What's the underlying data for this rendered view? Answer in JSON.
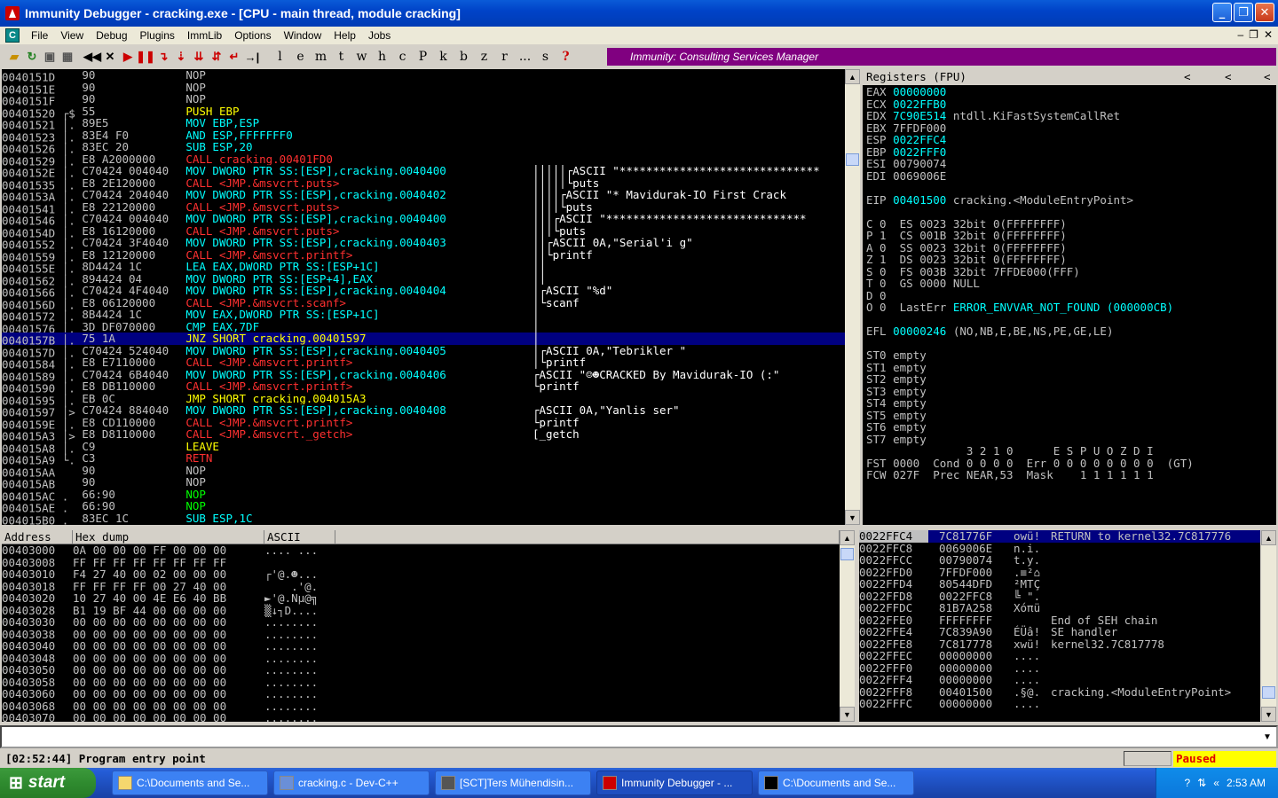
{
  "window": {
    "title": "Immunity Debugger - cracking.exe - [CPU - main thread, module cracking]"
  },
  "menu": [
    "File",
    "View",
    "Debug",
    "Plugins",
    "ImmLib",
    "Options",
    "Window",
    "Help",
    "Jobs"
  ],
  "toolbar_letters": [
    "l",
    "e",
    "m",
    "t",
    "w",
    "h",
    "c",
    "P",
    "k",
    "b",
    "z",
    "r",
    "...",
    "s",
    "?"
  ],
  "banner": "Immunity: Consulting Services Manager",
  "disasm": [
    [
      "0040151D",
      "",
      "90",
      "NOP",
      "c-w",
      ""
    ],
    [
      "0040151E",
      "",
      "90",
      "NOP",
      "c-w",
      ""
    ],
    [
      "0040151F",
      "",
      "90",
      "NOP",
      "c-w",
      ""
    ],
    [
      "00401520",
      "┌$",
      "55",
      "PUSH EBP",
      "c-y",
      ""
    ],
    [
      "00401521",
      "│.",
      "89E5",
      "MOV EBP,ESP",
      "c-cy",
      ""
    ],
    [
      "00401523",
      "│.",
      "83E4 F0",
      "AND ESP,FFFFFFF0",
      "c-cy",
      ""
    ],
    [
      "00401526",
      "│.",
      "83EC 20",
      "SUB ESP,20",
      "c-cy",
      ""
    ],
    [
      "00401529",
      "│.",
      "E8 A2000000",
      "CALL cracking.00401FD0",
      "c-r",
      ""
    ],
    [
      "0040152E",
      "│.",
      "C70424 004040",
      "MOV DWORD PTR SS:[ESP],cracking.0040400",
      "c-cy",
      "│││││┌ASCII \"******************************"
    ],
    [
      "00401535",
      "│.",
      "E8 2E120000",
      "CALL <JMP.&msvcrt.puts>",
      "c-r",
      "│││││└puts"
    ],
    [
      "0040153A",
      "│.",
      "C70424 204040",
      "MOV DWORD PTR SS:[ESP],cracking.0040402",
      "c-cy",
      "││││┌ASCII \"* Mavidurak-IO First Crack"
    ],
    [
      "00401541",
      "│.",
      "E8 22120000",
      "CALL <JMP.&msvcrt.puts>",
      "c-r",
      "││││└puts"
    ],
    [
      "00401546",
      "│.",
      "C70424 004040",
      "MOV DWORD PTR SS:[ESP],cracking.0040400",
      "c-cy",
      "│││┌ASCII \"******************************"
    ],
    [
      "0040154D",
      "│.",
      "E8 16120000",
      "CALL <JMP.&msvcrt.puts>",
      "c-r",
      "│││└puts"
    ],
    [
      "00401552",
      "│.",
      "C70424 3F4040",
      "MOV DWORD PTR SS:[ESP],cracking.0040403",
      "c-cy",
      "││┌ASCII 0A,\"Serial'i g\""
    ],
    [
      "00401559",
      "│.",
      "E8 12120000",
      "CALL <JMP.&msvcrt.printf>",
      "c-r",
      "││└printf"
    ],
    [
      "0040155E",
      "│.",
      "8D4424 1C",
      "LEA EAX,DWORD PTR SS:[ESP+1C]",
      "c-cy",
      "││"
    ],
    [
      "00401562",
      "│.",
      "894424 04",
      "MOV DWORD PTR SS:[ESP+4],EAX",
      "c-cy",
      "││"
    ],
    [
      "00401566",
      "│.",
      "C70424 4F4040",
      "MOV DWORD PTR SS:[ESP],cracking.0040404",
      "c-cy",
      "│┌ASCII \"%d\""
    ],
    [
      "0040156D",
      "│.",
      "E8 06120000",
      "CALL <JMP.&msvcrt.scanf>",
      "c-r",
      "│└scanf"
    ],
    [
      "00401572",
      "│.",
      "8B4424 1C",
      "MOV EAX,DWORD PTR SS:[ESP+1C]",
      "c-cy",
      "│"
    ],
    [
      "00401576",
      "│.",
      "3D DF070000",
      "CMP EAX,7DF",
      "c-cy",
      "│"
    ],
    [
      "0040157B",
      "│.",
      "75 1A",
      "JNZ SHORT cracking.00401597",
      "c-y",
      "│"
    ],
    [
      "0040157D",
      "│.",
      "C70424 524040",
      "MOV DWORD PTR SS:[ESP],cracking.0040405",
      "c-cy",
      "│┌ASCII 0A,\"Tebrikler \""
    ],
    [
      "00401584",
      "│.",
      "E8 E7110000",
      "CALL <JMP.&msvcrt.printf>",
      "c-r",
      "│└printf"
    ],
    [
      "00401589",
      "│.",
      "C70424 6B4040",
      "MOV DWORD PTR SS:[ESP],cracking.0040406",
      "c-cy",
      "┌ASCII \"☺☻CRACKED By Mavidurak-IO (:\""
    ],
    [
      "00401590",
      "│.",
      "E8 DB110000",
      "CALL <JMP.&msvcrt.printf>",
      "c-r",
      "└printf"
    ],
    [
      "00401595",
      "│.",
      "EB 0C",
      "JMP SHORT cracking.004015A3",
      "c-y",
      ""
    ],
    [
      "00401597",
      "│>",
      "C70424 884040",
      "MOV DWORD PTR SS:[ESP],cracking.0040408",
      "c-cy",
      "┌ASCII 0A,\"Yanlis ser\""
    ],
    [
      "0040159E",
      "│.",
      "E8 CD110000",
      "CALL <JMP.&msvcrt.printf>",
      "c-r",
      "└printf"
    ],
    [
      "004015A3",
      "│>",
      "E8 D8110000",
      "CALL <JMP.&msvcrt._getch>",
      "c-r",
      "[_getch"
    ],
    [
      "004015A8",
      "│.",
      "C9",
      "LEAVE",
      "c-y",
      ""
    ],
    [
      "004015A9",
      "└.",
      "C3",
      "RETN",
      "c-r",
      ""
    ],
    [
      "004015AA",
      "",
      "90",
      "NOP",
      "c-w",
      ""
    ],
    [
      "004015AB",
      "",
      "90",
      "NOP",
      "c-w",
      ""
    ],
    [
      "004015AC",
      ".",
      "66:90",
      "NOP",
      "c-g",
      ""
    ],
    [
      "004015AE",
      ".",
      "66:90",
      "NOP",
      "c-g",
      ""
    ],
    [
      "004015B0",
      ".",
      "83EC 1C",
      "SUB ESP,1C",
      "c-cy",
      ""
    ]
  ],
  "registers": {
    "title": "Registers (FPU)",
    "gp": [
      [
        "EAX",
        "00000000",
        ""
      ],
      [
        "ECX",
        "0022FFB0",
        ""
      ],
      [
        "EDX",
        "7C90E514",
        "ntdll.KiFastSystemCallRet"
      ],
      [
        "EBX",
        "7FFDF000",
        ""
      ],
      [
        "ESP",
        "0022FFC4",
        ""
      ],
      [
        "EBP",
        "0022FFF0",
        ""
      ],
      [
        "ESI",
        "00790074",
        ""
      ],
      [
        "EDI",
        "0069006E",
        ""
      ]
    ],
    "eip": [
      "EIP",
      "00401500",
      "cracking.<ModuleEntryPoint>"
    ],
    "flags": [
      "C 0  ES 0023 32bit 0(FFFFFFFF)",
      "P 1  CS 001B 32bit 0(FFFFFFFF)",
      "A 0  SS 0023 32bit 0(FFFFFFFF)",
      "Z 1  DS 0023 32bit 0(FFFFFFFF)",
      "S 0  FS 003B 32bit 7FFDE000(FFF)",
      "T 0  GS 0000 NULL",
      "D 0"
    ],
    "lasterr": [
      "O 0  LastErr ",
      "ERROR_ENVVAR_NOT_FOUND (000000CB)"
    ],
    "efl": [
      "EFL ",
      "00000246",
      " (NO,NB,E,BE,NS,PE,GE,LE)"
    ],
    "st": [
      "ST0 empty",
      "ST1 empty",
      "ST2 empty",
      "ST3 empty",
      "ST4 empty",
      "ST5 empty",
      "ST6 empty",
      "ST7 empty"
    ],
    "fpu": [
      "               3 2 1 0      E S P U O Z D I",
      "FST 0000  Cond 0 0 0 0  Err 0 0 0 0 0 0 0 0  (GT)",
      "FCW 027F  Prec NEAR,53  Mask    1 1 1 1 1 1"
    ]
  },
  "dump": {
    "headers": [
      "Address",
      "Hex dump",
      "ASCII"
    ],
    "rows": [
      [
        "00403000",
        "0A 00 00 00 FF 00 00 00",
        ".... ..."
      ],
      [
        "00403008",
        "FF FF FF FF FF FF FF FF",
        ""
      ],
      [
        "00403010",
        "F4 27 40 00 02 00 00 00",
        "┌'@.☻..."
      ],
      [
        "00403018",
        "FF FF FF FF 00 27 40 00",
        "    .'@."
      ],
      [
        "00403020",
        "10 27 40 00 4E E6 40 BB",
        "►'@.Nµ@╗"
      ],
      [
        "00403028",
        "B1 19 BF 44 00 00 00 00",
        "▒↓┐D...."
      ],
      [
        "00403030",
        "00 00 00 00 00 00 00 00",
        "........"
      ],
      [
        "00403038",
        "00 00 00 00 00 00 00 00",
        "........"
      ],
      [
        "00403040",
        "00 00 00 00 00 00 00 00",
        "........"
      ],
      [
        "00403048",
        "00 00 00 00 00 00 00 00",
        "........"
      ],
      [
        "00403050",
        "00 00 00 00 00 00 00 00",
        "........"
      ],
      [
        "00403058",
        "00 00 00 00 00 00 00 00",
        "........"
      ],
      [
        "00403060",
        "00 00 00 00 00 00 00 00",
        "........"
      ],
      [
        "00403068",
        "00 00 00 00 00 00 00 00",
        "........"
      ],
      [
        "00403070",
        "00 00 00 00 00 00 00 00",
        "........"
      ]
    ]
  },
  "stack": [
    [
      "0022FFC4",
      "7C81776F",
      "owü!",
      "RETURN to kernel32.7C817776"
    ],
    [
      "0022FFC8",
      "0069006E",
      "n.i.",
      ""
    ],
    [
      "0022FFCC",
      "00790074",
      "t.y.",
      ""
    ],
    [
      "0022FFD0",
      "7FFDF000",
      ".≡²⌂",
      ""
    ],
    [
      "0022FFD4",
      "80544DFD",
      "²MTÇ",
      ""
    ],
    [
      "0022FFD8",
      "0022FFC8",
      "╚ \".",
      ""
    ],
    [
      "0022FFDC",
      "81B7A258",
      "Xóπü",
      ""
    ],
    [
      "0022FFE0",
      "FFFFFFFF",
      "    ",
      "End of SEH chain"
    ],
    [
      "0022FFE4",
      "7C839A90",
      "ÉÜâ!",
      "SE handler"
    ],
    [
      "0022FFE8",
      "7C817778",
      "xwü!",
      "kernel32.7C817778"
    ],
    [
      "0022FFEC",
      "00000000",
      "....",
      ""
    ],
    [
      "0022FFF0",
      "00000000",
      "....",
      ""
    ],
    [
      "0022FFF4",
      "00000000",
      "....",
      ""
    ],
    [
      "0022FFF8",
      "00401500",
      ".§@.",
      "cracking.<ModuleEntryPoint>"
    ],
    [
      "0022FFFC",
      "00000000",
      "....",
      ""
    ]
  ],
  "status": {
    "message": "[02:52:44] Program entry point",
    "state": "Paused"
  },
  "taskbar": {
    "start": "start",
    "tasks": [
      "C:\\Documents and Se...",
      "cracking.c - Dev-C++",
      "[SCT]Ters Mühendisin...",
      "Immunity Debugger - ...",
      "C:\\Documents and Se..."
    ],
    "clock": "2:53 AM"
  }
}
